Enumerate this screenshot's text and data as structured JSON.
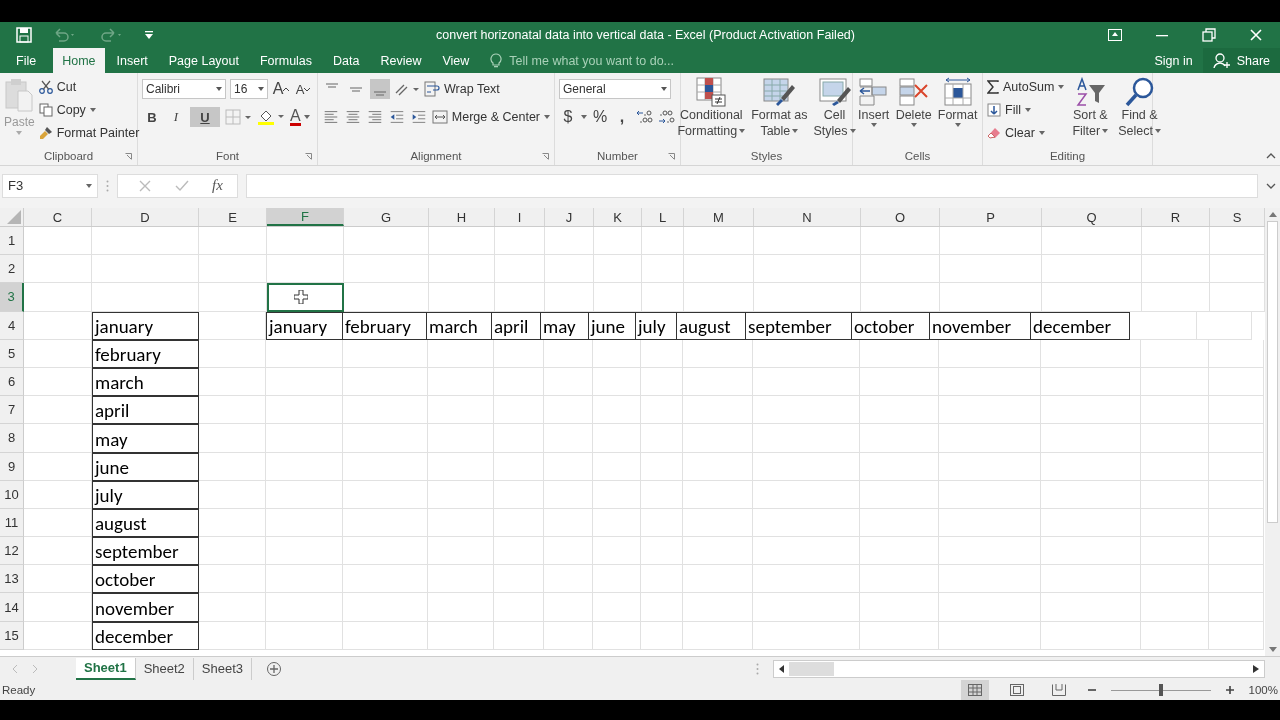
{
  "window": {
    "title": "convert horizonatal data into vertical data - Excel (Product Activation Failed)"
  },
  "tabs": [
    {
      "label": "File",
      "selected": false
    },
    {
      "label": "Home",
      "selected": true
    },
    {
      "label": "Insert",
      "selected": false
    },
    {
      "label": "Page Layout",
      "selected": false
    },
    {
      "label": "Formulas",
      "selected": false
    },
    {
      "label": "Data",
      "selected": false
    },
    {
      "label": "Review",
      "selected": false
    },
    {
      "label": "View",
      "selected": false
    }
  ],
  "tell_me": {
    "placeholder": "Tell me what you want to do..."
  },
  "sign_in": "Sign in",
  "share": "Share",
  "ribbon": {
    "clipboard": {
      "label": "Clipboard",
      "paste": "Paste",
      "cut": "Cut",
      "copy": "Copy",
      "format_painter": "Format Painter"
    },
    "font": {
      "label": "Font",
      "font_name": "Calibri",
      "font_size": "16",
      "grow": "A",
      "shrink": "A",
      "bold": {
        "text": "B",
        "selected": false
      },
      "italic": {
        "text": "I",
        "selected": false
      },
      "underline": {
        "text": "U",
        "selected": true
      },
      "font_color": "A"
    },
    "alignment": {
      "label": "Alignment",
      "vertical": [
        {
          "selected": false
        },
        {
          "selected": false
        },
        {
          "selected": true
        }
      ],
      "wrap_text": "Wrap Text",
      "merge_center": "Merge & Center"
    },
    "number": {
      "label": "Number",
      "format": "General",
      "currency": "$",
      "percent": "%",
      "comma": ","
    },
    "styles": {
      "label": "Styles",
      "buttons": [
        {
          "kind": "conditional",
          "lines": [
            "Conditional",
            "Formatting"
          ]
        },
        {
          "kind": "table",
          "lines": [
            "Format as",
            "Table"
          ]
        },
        {
          "kind": "cell",
          "lines": [
            "Cell",
            "Styles"
          ]
        }
      ]
    },
    "cells": {
      "label": "Cells",
      "buttons": [
        {
          "kind": "insert",
          "text": "Insert"
        },
        {
          "kind": "delete",
          "text": "Delete"
        },
        {
          "kind": "format",
          "text": "Format"
        }
      ]
    },
    "editing": {
      "label": "Editing",
      "autosum": "AutoSum",
      "fill": "Fill",
      "clear": "Clear",
      "sort": [
        "Sort &",
        "Filter"
      ],
      "find": [
        "Find &",
        "Select"
      ]
    }
  },
  "name_box": "F3",
  "fx": "fx",
  "columns": [
    {
      "label": "C",
      "selected": false
    },
    {
      "label": "D",
      "selected": false
    },
    {
      "label": "E",
      "selected": false
    },
    {
      "label": "F",
      "selected": true
    },
    {
      "label": "G",
      "selected": false
    },
    {
      "label": "H",
      "selected": false
    },
    {
      "label": "I",
      "selected": false
    },
    {
      "label": "J",
      "selected": false
    },
    {
      "label": "K",
      "selected": false
    },
    {
      "label": "L",
      "selected": false
    },
    {
      "label": "M",
      "selected": false
    },
    {
      "label": "N",
      "selected": false
    },
    {
      "label": "O",
      "selected": false
    },
    {
      "label": "P",
      "selected": false
    },
    {
      "label": "Q",
      "selected": false
    },
    {
      "label": "R",
      "selected": false
    },
    {
      "label": "S",
      "selected": false
    }
  ],
  "rows": [
    {
      "label": "1",
      "selected": false
    },
    {
      "label": "2",
      "selected": false
    },
    {
      "label": "3",
      "selected": true
    },
    {
      "label": "4",
      "selected": false,
      "cells": {
        "D": "january",
        "F": "january",
        "G": "february",
        "H": "march",
        "I": "april",
        "J": "may",
        "K": "june",
        "L": "july",
        "M": "august",
        "N": "september",
        "O": "october",
        "P": "november",
        "Q": "december"
      }
    },
    {
      "label": "5",
      "selected": false,
      "cells": {
        "D": "february"
      }
    },
    {
      "label": "6",
      "selected": false,
      "cells": {
        "D": "march"
      }
    },
    {
      "label": "7",
      "selected": false,
      "cells": {
        "D": "april"
      }
    },
    {
      "label": "8",
      "selected": false,
      "cells": {
        "D": "may"
      }
    },
    {
      "label": "9",
      "selected": false,
      "cells": {
        "D": "june"
      }
    },
    {
      "label": "10",
      "selected": false,
      "cells": {
        "D": "july"
      }
    },
    {
      "label": "11",
      "selected": false,
      "cells": {
        "D": "august"
      }
    },
    {
      "label": "12",
      "selected": false,
      "cells": {
        "D": "september"
      }
    },
    {
      "label": "13",
      "selected": false,
      "cells": {
        "D": "october"
      }
    },
    {
      "label": "14",
      "selected": false,
      "cells": {
        "D": "november"
      }
    },
    {
      "label": "15",
      "selected": false,
      "cells": {
        "D": "december"
      }
    }
  ],
  "sheets": [
    {
      "label": "Sheet1",
      "selected": true
    },
    {
      "label": "Sheet2",
      "selected": false
    },
    {
      "label": "Sheet3",
      "selected": false
    }
  ],
  "status_bar": {
    "text": "Ready",
    "views": [
      {
        "kind": "normal",
        "selected": true
      },
      {
        "kind": "page_layout",
        "selected": false
      },
      {
        "kind": "page_break",
        "selected": false
      }
    ],
    "zoom": {
      "label": "100%",
      "level": 0.5
    }
  }
}
